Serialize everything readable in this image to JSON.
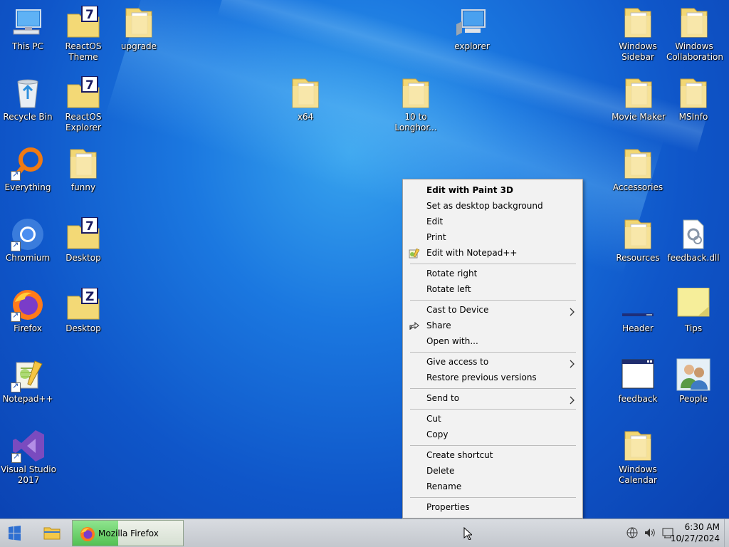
{
  "desktop": {
    "icons": [
      {
        "label": "This PC"
      },
      {
        "label": "ReactOS\nTheme"
      },
      {
        "label": "upgrade"
      },
      {
        "label": "explorer"
      },
      {
        "label": "Windows\nSidebar"
      },
      {
        "label": "Windows\nCollaboration"
      },
      {
        "label": "Recycle Bin"
      },
      {
        "label": "ReactOS\nExplorer"
      },
      {
        "label": "x64"
      },
      {
        "label": "10 to\nLonghor..."
      },
      {
        "label": "Movie Maker"
      },
      {
        "label": "MSInfo"
      },
      {
        "label": "Everything"
      },
      {
        "label": "funny"
      },
      {
        "label": "Accessories"
      },
      {
        "label": "Chromium"
      },
      {
        "label": "Desktop"
      },
      {
        "label": "Resources"
      },
      {
        "label": "feedback.dll"
      },
      {
        "label": "Firefox"
      },
      {
        "label": "Desktop"
      },
      {
        "label": "Header"
      },
      {
        "label": "Tips"
      },
      {
        "label": "Notepad++"
      },
      {
        "label": "feedback"
      },
      {
        "label": "People"
      },
      {
        "label": "Visual Studio\n2017"
      },
      {
        "label": "Windows\nCalendar"
      }
    ]
  },
  "context_menu": {
    "items": [
      {
        "label": "Edit with Paint 3D"
      },
      {
        "label": "Set as desktop background"
      },
      {
        "label": "Edit"
      },
      {
        "label": "Print"
      },
      {
        "label": "Edit with Notepad++"
      },
      {
        "label": "Rotate right"
      },
      {
        "label": "Rotate left"
      },
      {
        "label": "Cast to Device"
      },
      {
        "label": "Share"
      },
      {
        "label": "Open with..."
      },
      {
        "label": "Give access to"
      },
      {
        "label": "Restore previous versions"
      },
      {
        "label": "Send to"
      },
      {
        "label": "Cut"
      },
      {
        "label": "Copy"
      },
      {
        "label": "Create shortcut"
      },
      {
        "label": "Delete"
      },
      {
        "label": "Rename"
      },
      {
        "label": "Properties"
      }
    ]
  },
  "taskbar": {
    "app_label": "Mozilla Firefox",
    "time": "6:30 AM",
    "date": "10/27/2024"
  }
}
